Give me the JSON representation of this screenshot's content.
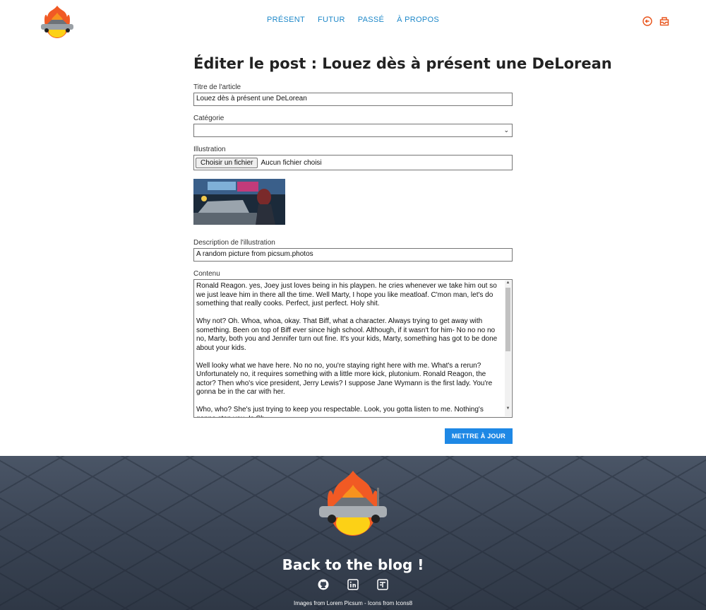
{
  "nav": {
    "items": [
      "PRÉSENT",
      "FUTUR",
      "PASSÉ",
      "À PROPOS"
    ]
  },
  "header_icons": [
    "logout-icon",
    "inbox-icon"
  ],
  "form": {
    "heading": "Éditer le post : Louez dès à présent une DeLorean",
    "title_label": "Titre de l'article",
    "title_value": "Louez dès à présent une DeLorean",
    "category_label": "Catégorie",
    "category_value": "",
    "illustration_label": "Illustration",
    "file_button": "Choisir un fichier",
    "file_status": "Aucun fichier choisi",
    "alt_label": "Description de l'illustration",
    "alt_value": "A random picture from picsum.photos",
    "content_label": "Contenu",
    "content_value": "Ronald Reagon. yes, Joey just loves being in his playpen. he cries whenever we take him out so we just leave him in there all the time. Well Marty, I hope you like meatloaf. C'mon man, let's do something that really cooks. Perfect, just perfect. Holy shit.\n\nWhy not? Oh. Whoa, whoa, okay. That Biff, what a character. Always trying to get away with something. Been on top of Biff ever since high school. Although, if it wasn't for him- No no no no no, Marty, both you and Jennifer turn out fine. It's your kids, Marty, something has got to be done about your kids.\n\nWell looky what we have here. No no no, you're staying right here with me. What's a rerun? Unfortunately no, it requires something with a little more kick, plutonium. Ronald Reagon, the actor? Then who's vice president, Jerry Lewis? I suppose Jane Wymann is the first lady. You're gonna be in the car with her.\n\nWho, who? She's just trying to keep you respectable. Look, you gotta listen to me. Nothing's gonna stop you, Is Sh",
    "submit_label": "METTRE À JOUR"
  },
  "footer": {
    "title": "Back to the blog !",
    "icons": [
      "github-icon",
      "linkedin-icon",
      "portfolio-icon"
    ],
    "credit": "Images from Lorem Picsum - Icons from Icons8"
  },
  "colors": {
    "accent": "#1e88e5",
    "nav": "#1e88c9",
    "icon_orange": "#e8531a",
    "footer_bg": "#3a4454"
  }
}
